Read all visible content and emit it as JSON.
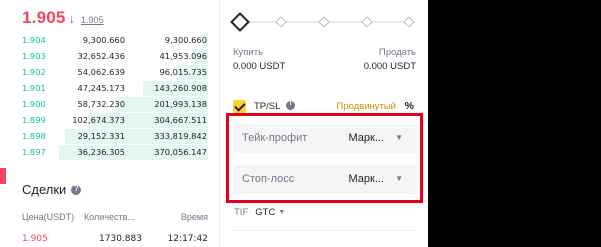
{
  "order_book": {
    "last_price": "1.905",
    "last_arrow": "↓",
    "mark_price": "1.905",
    "bids": [
      {
        "price": "1.904",
        "amount": "9,300.660",
        "total": "9,300.660",
        "depth": 0.02
      },
      {
        "price": "1.903",
        "amount": "32,652.436",
        "total": "41,953.096",
        "depth": 0.08
      },
      {
        "price": "1.902",
        "amount": "54,062.639",
        "total": "96,015.735",
        "depth": 0.16
      },
      {
        "price": "1.901",
        "amount": "47,245.173",
        "total": "143,260.908",
        "depth": 0.33
      },
      {
        "price": "1.900",
        "amount": "58,732.230",
        "total": "201,993.138",
        "depth": 0.47
      },
      {
        "price": "1.899",
        "amount": "102,674.373",
        "total": "304,667.511",
        "depth": 0.61
      },
      {
        "price": "1.898",
        "amount": "29,152.331",
        "total": "333,819.842",
        "depth": 0.73
      },
      {
        "price": "1.897",
        "amount": "36,236.305",
        "total": "370,056.147",
        "depth": 0.76
      }
    ],
    "colors": {
      "bid": "#0ecb81",
      "ask": "#f6465d",
      "bid_bg": "#e4f6ee"
    }
  },
  "trades": {
    "title": "Сделки",
    "title_icon": "question-circle-icon",
    "headers": {
      "price": "Цена(USDT)",
      "qty": "Количеств...",
      "time": "Время"
    },
    "rows": [
      {
        "price": "1.905",
        "qty": "1730.883",
        "time": "12:17:42"
      }
    ]
  },
  "order_form": {
    "slider_percent": 0,
    "buy_label": "Купить",
    "buy_value": "0.000 USDT",
    "sell_label": "Продать",
    "sell_value": "0.000 USDT",
    "tpsl_label": "TP/SL",
    "tpsl_checked": true,
    "advanced_label": "Продвинутый",
    "percent_icon": "%",
    "take_profit": {
      "label": "Тейк-профит",
      "value": "Марк..."
    },
    "stop_loss": {
      "label": "Стоп-лосс",
      "value": "Марк..."
    },
    "tif_label": "TIF",
    "tif_value": "GTC",
    "accent": "#fcd535",
    "highlight_color": "#e5001c"
  }
}
